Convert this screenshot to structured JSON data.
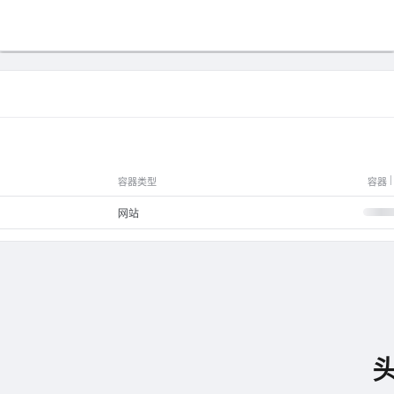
{
  "table": {
    "columns": {
      "container_type": "容器类型",
      "container_status": "容器"
    },
    "rows": [
      {
        "container_type": "网站",
        "status": "loading"
      }
    ]
  },
  "watermark": {
    "text": "头"
  },
  "colors": {
    "page_bg": "#f1f2f5",
    "card_bg": "#ffffff",
    "header_text": "#8a8d93",
    "cell_text": "#4a4d52"
  }
}
